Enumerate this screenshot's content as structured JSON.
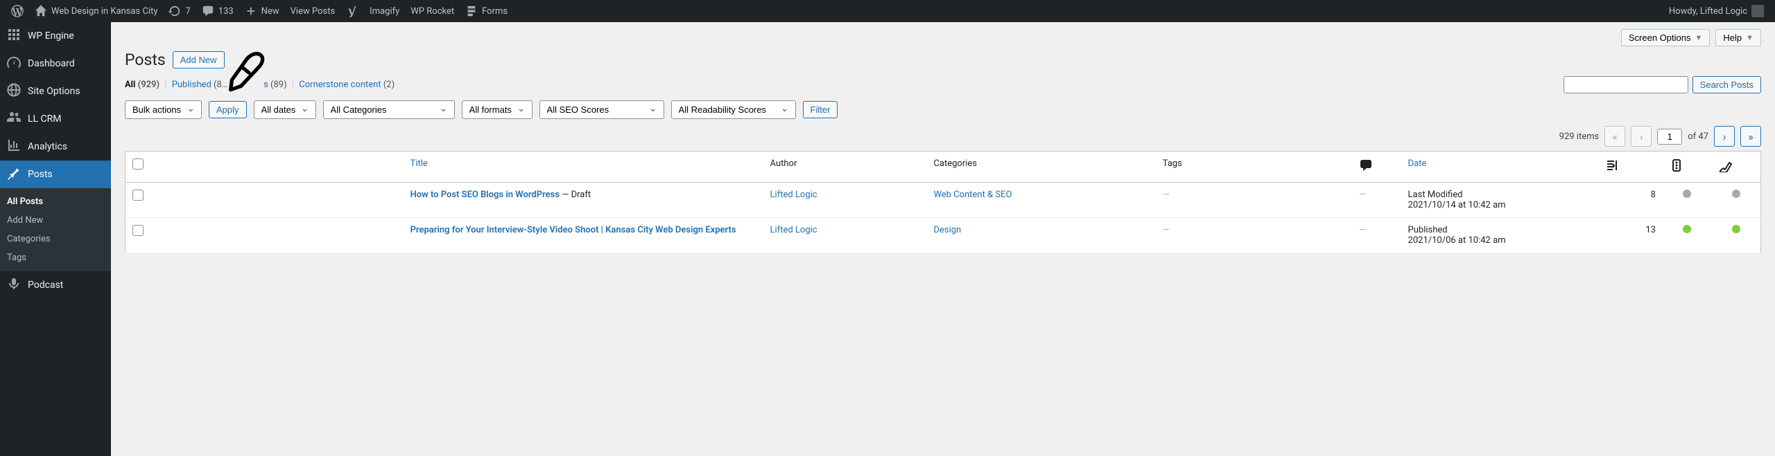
{
  "topbar": {
    "site_name": "Web Design in Kansas City",
    "updates_count": "7",
    "comments_count": "133",
    "new_label": "New",
    "view_posts_label": "View Posts",
    "imagify_label": "Imagify",
    "wp_rocket_label": "WP Rocket",
    "forms_label": "Forms",
    "howdy": "Howdy, Lifted Logic"
  },
  "sidebar": {
    "items": [
      {
        "label": "WP Engine"
      },
      {
        "label": "Dashboard"
      },
      {
        "label": "Site Options"
      },
      {
        "label": "LL CRM"
      },
      {
        "label": "Analytics"
      },
      {
        "label": "Posts"
      },
      {
        "label": "Podcast"
      }
    ],
    "sub": {
      "all_posts": "All Posts",
      "add_new": "Add New",
      "categories": "Categories",
      "tags": "Tags"
    }
  },
  "main": {
    "screen_options": "Screen Options",
    "help": "Help",
    "page_title": "Posts",
    "add_new_btn": "Add New",
    "filters": {
      "all": "All",
      "all_count": "(929)",
      "published": "Published",
      "published_count": "(8…",
      "drafts_suffix": "s",
      "drafts_count": "(89)",
      "cornerstone": "Cornerstone content",
      "cornerstone_count": "(2)"
    },
    "search_btn": "Search Posts",
    "bulk_actions": "Bulk actions",
    "apply_btn": "Apply",
    "all_dates": "All dates",
    "all_categories": "All Categories",
    "all_formats": "All formats",
    "all_seo": "All SEO Scores",
    "all_readability": "All Readability Scores",
    "filter_btn": "Filter",
    "items_count": "929 items",
    "page_current": "1",
    "page_of": "of 47"
  },
  "table": {
    "headers": {
      "title": "Title",
      "author": "Author",
      "categories": "Categories",
      "tags": "Tags",
      "date": "Date"
    },
    "rows": [
      {
        "title": "How to Post SEO Blogs in WordPress",
        "title_suffix": " — Draft",
        "author": "Lifted Logic",
        "categories": "Web Content & SEO",
        "tags": "—",
        "comments": "—",
        "date_status": "Last Modified",
        "date_value": "2021/10/14 at 10:42 am",
        "links": "8",
        "seo_dot": "gray",
        "read_dot": "gray"
      },
      {
        "title": "Preparing for Your Interview-Style Video Shoot | Kansas City Web Design Experts",
        "title_suffix": "",
        "author": "Lifted Logic",
        "categories": "Design",
        "tags": "—",
        "comments": "—",
        "date_status": "Published",
        "date_value": "2021/10/06 at 10:42 am",
        "links": "13",
        "seo_dot": "green",
        "read_dot": "green"
      }
    ]
  }
}
